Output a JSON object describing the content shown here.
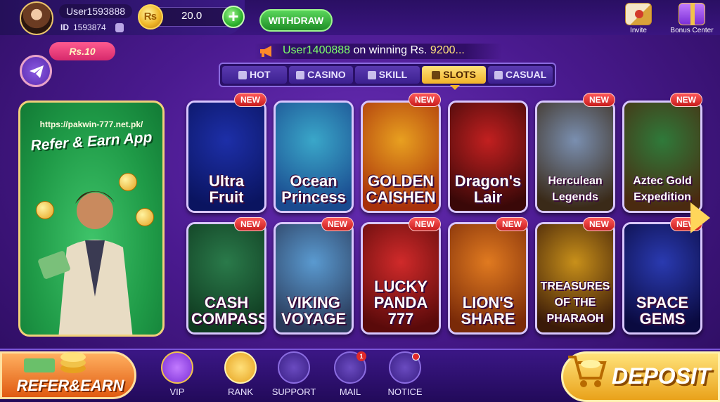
{
  "user": {
    "username": "User1593888",
    "id_label": "ID",
    "id_value": "1593874",
    "balance": "20.0"
  },
  "header": {
    "withdraw_label": "WITHDRAW",
    "invite_label": "Invite",
    "bonus_label": "Bonus Center"
  },
  "reward_bubble": "Rs.10",
  "marquee": {
    "user": "User1400888",
    "middle": " on winning Rs. ",
    "amount": "9200..."
  },
  "tabs": [
    {
      "label": "HOT",
      "icon": "flame-icon"
    },
    {
      "label": "CASINO",
      "icon": "chip-icon"
    },
    {
      "label": "SKILL",
      "icon": "gamepad-icon"
    },
    {
      "label": "SLOTS",
      "icon": "slot-icon",
      "active": true
    },
    {
      "label": "CASUAL",
      "icon": "gamepad-icon"
    }
  ],
  "banner": {
    "url": "https://pakwin-777.net.pk/",
    "title": "Refer & Earn App"
  },
  "games": [
    {
      "title": "Ultra Fruit",
      "new": true,
      "colors": [
        "#1d2fa8",
        "#0a1460"
      ]
    },
    {
      "title": "Ocean Princess",
      "new": false,
      "colors": [
        "#3aa7c9",
        "#1a4a8f"
      ]
    },
    {
      "title": "GOLDEN CAISHEN",
      "new": true,
      "colors": [
        "#e8a020",
        "#a8300a"
      ]
    },
    {
      "title": "Dragon's Lair",
      "new": false,
      "colors": [
        "#c22020",
        "#3a0808"
      ]
    },
    {
      "title": "Herculean Legends",
      "new": true,
      "colors": [
        "#7a8fb0",
        "#3a2a18"
      ]
    },
    {
      "title": "Aztec Gold Expedition",
      "new": true,
      "colors": [
        "#2f7a3a",
        "#4a2a10"
      ]
    },
    {
      "title": "CASH COMPASS",
      "new": true,
      "colors": [
        "#2a7a4a",
        "#0f3a20"
      ]
    },
    {
      "title": "VIKING VOYAGE",
      "new": true,
      "colors": [
        "#5a9ad0",
        "#2a3a5a"
      ]
    },
    {
      "title": "LUCKY PANDA 777",
      "new": true,
      "colors": [
        "#d02a2a",
        "#5a0a0a"
      ]
    },
    {
      "title": "LION'S SHARE",
      "new": true,
      "colors": [
        "#e07a20",
        "#7a2a08"
      ]
    },
    {
      "title": "TREASURES OF THE PHARAOH",
      "new": true,
      "colors": [
        "#c8901a",
        "#3a1a08"
      ]
    },
    {
      "title": "SPACE GEMS",
      "new": true,
      "colors": [
        "#2a3ab0",
        "#0a0a40"
      ]
    }
  ],
  "new_badge": "NEW",
  "bottom_nav": {
    "refer_earn": "REFER&EARN",
    "vip": "VIP",
    "rank": "RANK",
    "support": "SUPPORT",
    "mail": "MAIL",
    "mail_count": "1",
    "notice": "NOTICE",
    "deposit": "DEPOSIT"
  }
}
